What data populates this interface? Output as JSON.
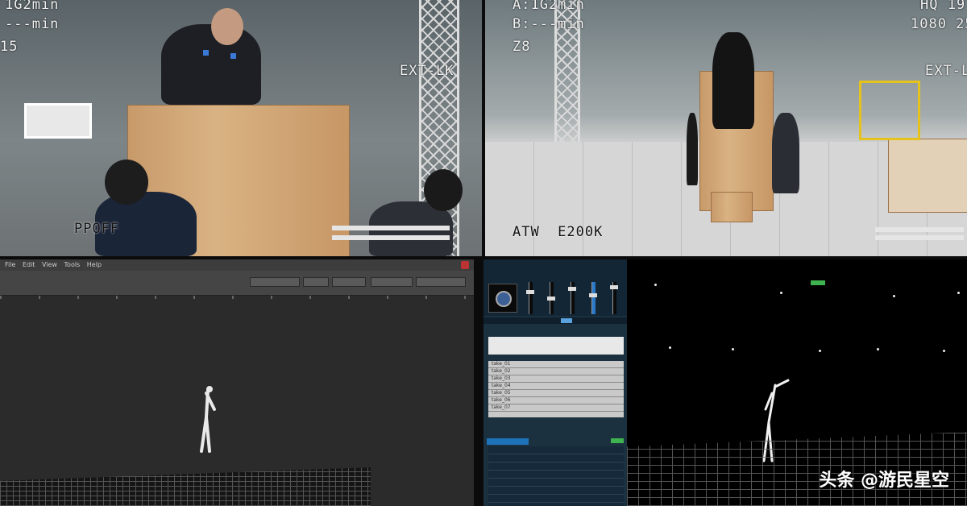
{
  "top_left": {
    "osd_line1": "1G2min",
    "osd_line2": "---min",
    "osd_line3": "15",
    "osd_mode": "EXT-LK",
    "osd_bottom": "PPOFF"
  },
  "top_right": {
    "osd_line1": "A:1G2min",
    "osd_line2": "B:---min",
    "osd_line3": "Z8",
    "osd_res1": "HQ 19",
    "osd_res2": "1080 25",
    "osd_mode": "EXT-L",
    "osd_bottom": "ATW  E200K"
  },
  "bottom_left": {
    "menu_items": [
      "File",
      "Edit",
      "View",
      "Tools",
      "Help"
    ]
  },
  "bottom_right": {
    "list_rows": [
      "take_01",
      "take_02",
      "take_03",
      "take_04",
      "take_05",
      "take_06",
      "take_07"
    ],
    "tags": [
      "",
      ""
    ]
  },
  "watermark": "头条 @游民星空"
}
